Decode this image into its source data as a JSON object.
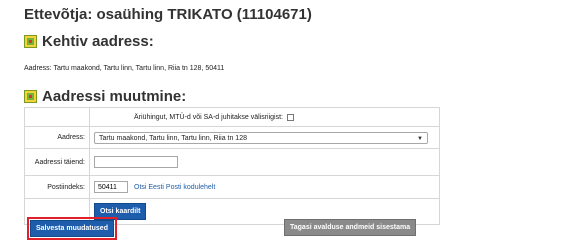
{
  "page": {
    "title": "Ettevõtja: osaühing TRIKATO (11104671)"
  },
  "current_section": {
    "heading": "Kehtiv aadress:",
    "icon": "map-icon",
    "address_text": "Aadress: Tartu maakond, Tartu linn, Tartu linn, Riia tn 128, 50411"
  },
  "change_section": {
    "heading": "Aadressi muutmine:",
    "icon": "map-icon",
    "foreign_label": "Äriühingut, MTÜ-d või SA-d juhitakse välisriigist:",
    "foreign_checked": false,
    "address_label": "Aadress:",
    "address_value": "Tartu maakond, Tartu linn, Tartu linn, Riia tn 128",
    "supplement_label": "Aadressi täiend:",
    "supplement_value": "",
    "postal_label": "Postiindeks:",
    "postal_value": "50411",
    "postal_link": "Otsi Eesti Posti kodulehelt",
    "map_button": "Otsi kaardilt"
  },
  "actions": {
    "save_label": "Salvesta muudatused",
    "back_label": "Tagasi avalduse andmeid sisestama"
  },
  "colors": {
    "primary_button": "#1d5dab",
    "secondary_button": "#8a8a8a",
    "highlight_border": "#e2202b",
    "link": "#1f5ea8"
  }
}
